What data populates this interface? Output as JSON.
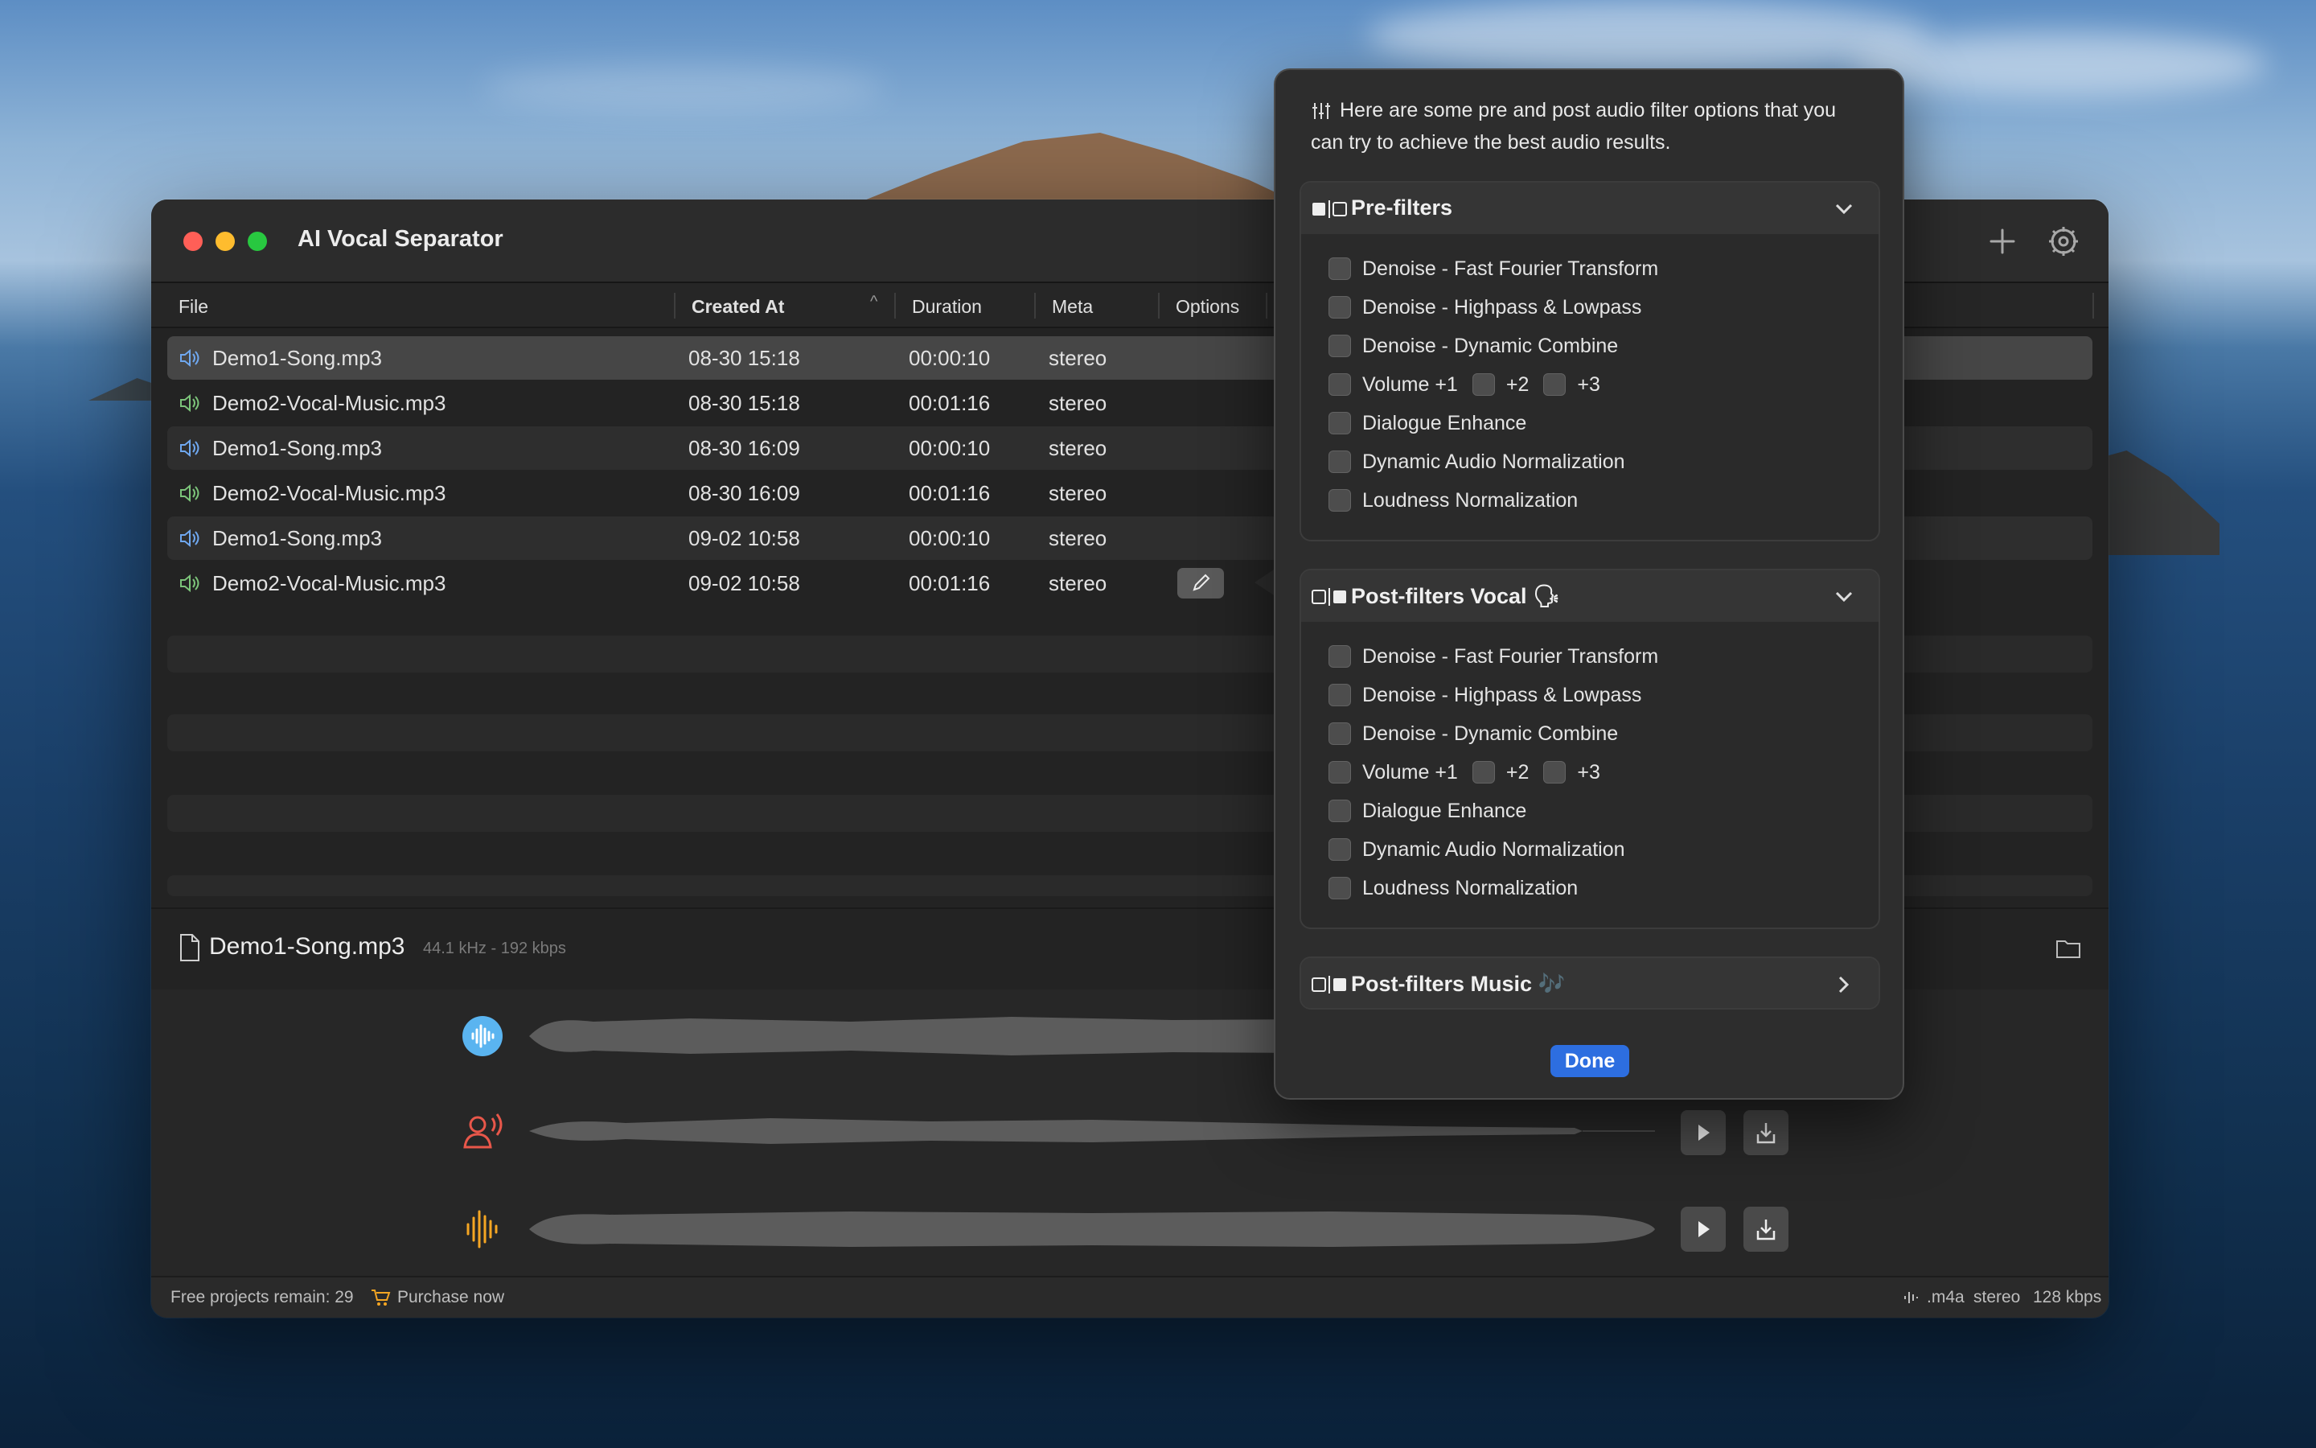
{
  "window": {
    "title": "AI Vocal Separator",
    "add_icon": "plus-icon",
    "settings_icon": "gear-icon"
  },
  "table": {
    "columns": [
      "File",
      "Created At",
      "Duration",
      "Meta",
      "Options"
    ],
    "sort_indicator": "^",
    "rows": [
      {
        "file": "Demo1-Song.mp3",
        "created": "08-30 15:18",
        "duration": "00:00:10",
        "meta": "stereo"
      },
      {
        "file": "Demo2-Vocal-Music.mp3",
        "created": "08-30 15:18",
        "duration": "00:01:16",
        "meta": "stereo"
      },
      {
        "file": "Demo1-Song.mp3",
        "created": "08-30 16:09",
        "duration": "00:00:10",
        "meta": "stereo"
      },
      {
        "file": "Demo2-Vocal-Music.mp3",
        "created": "08-30 16:09",
        "duration": "00:01:16",
        "meta": "stereo"
      },
      {
        "file": "Demo1-Song.mp3",
        "created": "09-02 10:58",
        "duration": "00:00:10",
        "meta": "stereo"
      },
      {
        "file": "Demo2-Vocal-Music.mp3",
        "created": "09-02 10:58",
        "duration": "00:01:16",
        "meta": "stereo"
      }
    ]
  },
  "detail": {
    "file_name": "Demo1-Song.mp3",
    "file_meta": "44.1 kHz - 192 kbps",
    "tracks": [
      "vocal-waveform-icon",
      "person-speaking-icon",
      "music-waveform-icon"
    ]
  },
  "status": {
    "free_projects": "Free projects remain: 29",
    "purchase": "Purchase now",
    "format": ".m4a",
    "channels": "stereo",
    "bitrate": "128 kbps"
  },
  "popover": {
    "intro": "Here are some pre and post audio filter options that you can try to achieve the best audio results.",
    "pre_filters": {
      "title": "Pre-filters",
      "options": [
        "Denoise - Fast Fourier Transform",
        "Denoise - Highpass & Lowpass",
        "Denoise - Dynamic Combine",
        "Volume +1",
        "+2",
        "+3",
        "Dialogue Enhance",
        "Dynamic Audio Normalization",
        "Loudness Normalization"
      ]
    },
    "post_vocal": {
      "title": "Post-filters Vocal 🗣",
      "options": [
        "Denoise - Fast Fourier Transform",
        "Denoise - Highpass & Lowpass",
        "Denoise - Dynamic Combine",
        "Volume +1",
        "+2",
        "+3",
        "Dialogue Enhance",
        "Dynamic Audio Normalization",
        "Loudness Normalization"
      ]
    },
    "post_music": {
      "title": "Post-filters Music 🎶"
    },
    "done": "Done"
  },
  "colors": {
    "accent": "#2d6ee0",
    "vocal_icon": "#5ab4f0",
    "speech_icon": "#e8574a",
    "music_icon": "#f5a623",
    "speaker_blue": "#6fa8f0",
    "speaker_green": "#7cc47a"
  }
}
